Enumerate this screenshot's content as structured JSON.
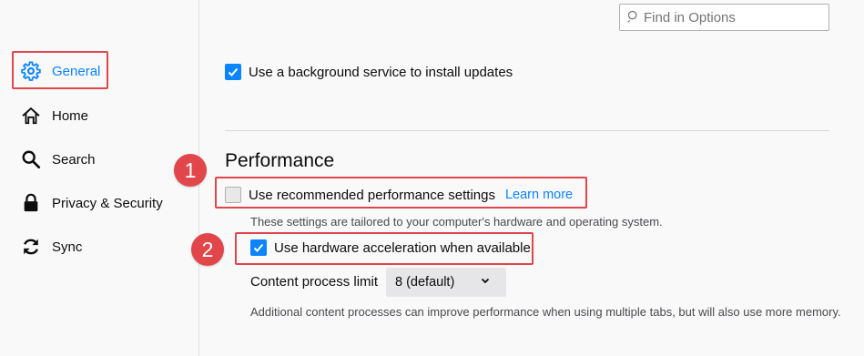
{
  "search": {
    "placeholder": "Find in Options"
  },
  "sidebar": {
    "items": [
      {
        "label": "General",
        "icon": "gear-icon",
        "selected": true
      },
      {
        "label": "Home",
        "icon": "home-icon",
        "selected": false
      },
      {
        "label": "Search",
        "icon": "search-icon",
        "selected": false
      },
      {
        "label": "Privacy & Security",
        "icon": "lock-icon",
        "selected": false
      },
      {
        "label": "Sync",
        "icon": "sync-icon",
        "selected": false
      }
    ]
  },
  "updates": {
    "background_service_label": "Use a background service to install updates",
    "background_service_checked": true
  },
  "performance": {
    "title": "Performance",
    "recommended_label": "Use recommended performance settings",
    "recommended_checked": false,
    "learn_more": "Learn more",
    "tailored_desc": "These settings are tailored to your computer's hardware and operating system.",
    "hardware_accel_label": "Use hardware acceleration when available",
    "hardware_accel_checked": true,
    "content_process_label": "Content process limit",
    "content_process_value": "8 (default)",
    "content_process_desc": "Additional content processes can improve performance when using multiple tabs, but will also use more memory."
  },
  "annotations": {
    "badge_1": "1",
    "badge_2": "2"
  },
  "colors": {
    "accent": "#0a84ff",
    "highlight": "#e0464a"
  }
}
